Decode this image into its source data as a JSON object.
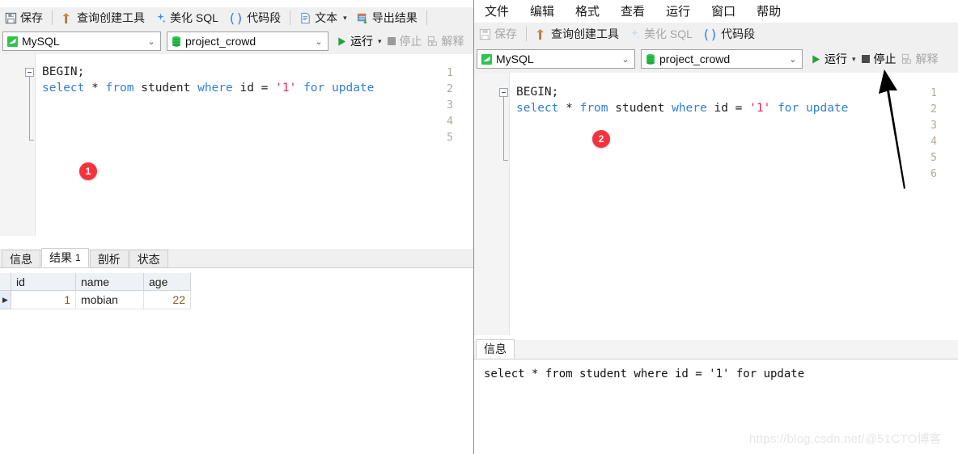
{
  "left_panel": {
    "toolbar": {
      "items": [
        {
          "label": "保存",
          "icon": "save-icon",
          "disabled": false
        },
        {
          "label": "查询创建工具",
          "icon": "query-builder-icon",
          "disabled": false
        },
        {
          "label": "美化 SQL",
          "icon": "beautify-sql-icon",
          "disabled": false
        },
        {
          "label": "代码段",
          "icon": "code-snippet-icon",
          "disabled": false
        },
        {
          "label": "文本",
          "icon": "text-icon",
          "disabled": false
        },
        {
          "label": "导出结果",
          "icon": "export-result-icon",
          "disabled": false
        }
      ]
    },
    "connection": {
      "server": "MySQL",
      "database": "project_crowd",
      "run_label": "运行",
      "stop_label": "停止",
      "explain_label": "解释"
    },
    "editor": {
      "line_numbers": [
        "1",
        "2",
        "3",
        "4",
        "5"
      ],
      "lines": [
        {
          "parts": [
            {
              "t": "BEGIN;",
              "c": "plain"
            }
          ]
        },
        {
          "parts": [
            {
              "t": "select",
              "c": "kw"
            },
            {
              "t": " * ",
              "c": "plain"
            },
            {
              "t": "from",
              "c": "kw"
            },
            {
              "t": " student ",
              "c": "plain"
            },
            {
              "t": "where",
              "c": "kw"
            },
            {
              "t": " id = ",
              "c": "plain"
            },
            {
              "t": "'1'",
              "c": "str"
            },
            {
              "t": " ",
              "c": "plain"
            },
            {
              "t": "for",
              "c": "kw"
            },
            {
              "t": " ",
              "c": "plain"
            },
            {
              "t": "update",
              "c": "kw"
            }
          ]
        },
        {
          "parts": []
        },
        {
          "parts": []
        },
        {
          "parts": []
        }
      ]
    },
    "badge": "1",
    "result_tabs": [
      {
        "label": "信息",
        "count": "",
        "active": false
      },
      {
        "label": "结果",
        "count": "1",
        "active": true
      },
      {
        "label": "剖析",
        "count": "",
        "active": false
      },
      {
        "label": "状态",
        "count": "",
        "active": false
      }
    ],
    "result_grid": {
      "columns": [
        "id",
        "name",
        "age"
      ],
      "rows": [
        {
          "id": "1",
          "name": "mobian",
          "age": "22"
        }
      ]
    }
  },
  "right_panel": {
    "menubar": [
      "文件",
      "编辑",
      "格式",
      "查看",
      "运行",
      "窗口",
      "帮助"
    ],
    "toolbar": {
      "items": [
        {
          "label": "保存",
          "icon": "save-icon",
          "disabled": true
        },
        {
          "label": "查询创建工具",
          "icon": "query-builder-icon",
          "disabled": false
        },
        {
          "label": "美化 SQL",
          "icon": "beautify-sql-icon",
          "disabled": true
        },
        {
          "label": "代码段",
          "icon": "code-snippet-icon",
          "disabled": false
        }
      ]
    },
    "connection": {
      "server": "MySQL",
      "database": "project_crowd",
      "run_label": "运行",
      "stop_label": "停止",
      "explain_label": "解释"
    },
    "editor": {
      "line_numbers": [
        "1",
        "2",
        "3",
        "4",
        "5",
        "6"
      ],
      "lines": [
        {
          "parts": [
            {
              "t": "BEGIN;",
              "c": "plain"
            }
          ]
        },
        {
          "parts": [
            {
              "t": "select",
              "c": "kw"
            },
            {
              "t": " * ",
              "c": "plain"
            },
            {
              "t": "from",
              "c": "kw"
            },
            {
              "t": " student ",
              "c": "plain"
            },
            {
              "t": "where",
              "c": "kw"
            },
            {
              "t": " id = ",
              "c": "plain"
            },
            {
              "t": "'1'",
              "c": "str"
            },
            {
              "t": " ",
              "c": "plain"
            },
            {
              "t": "for",
              "c": "kw"
            },
            {
              "t": " ",
              "c": "plain"
            },
            {
              "t": "update",
              "c": "kw"
            }
          ]
        },
        {
          "parts": []
        },
        {
          "parts": []
        },
        {
          "parts": []
        },
        {
          "parts": []
        }
      ]
    },
    "badge": "2",
    "message_tabs": [
      {
        "label": "信息",
        "active": true
      }
    ],
    "message_text": "select * from student where id = '1' for update"
  },
  "annotation": {
    "arrow_target": "停止"
  },
  "watermark": "https://blog.csdn.net/@51CTO博客",
  "colors": {
    "badge_red": "#f5333f",
    "run_green": "#22a33a",
    "keyword_blue": "#2f7fd8",
    "string_red": "#e8245b",
    "toolbar_bg": "#f0f0f0"
  }
}
